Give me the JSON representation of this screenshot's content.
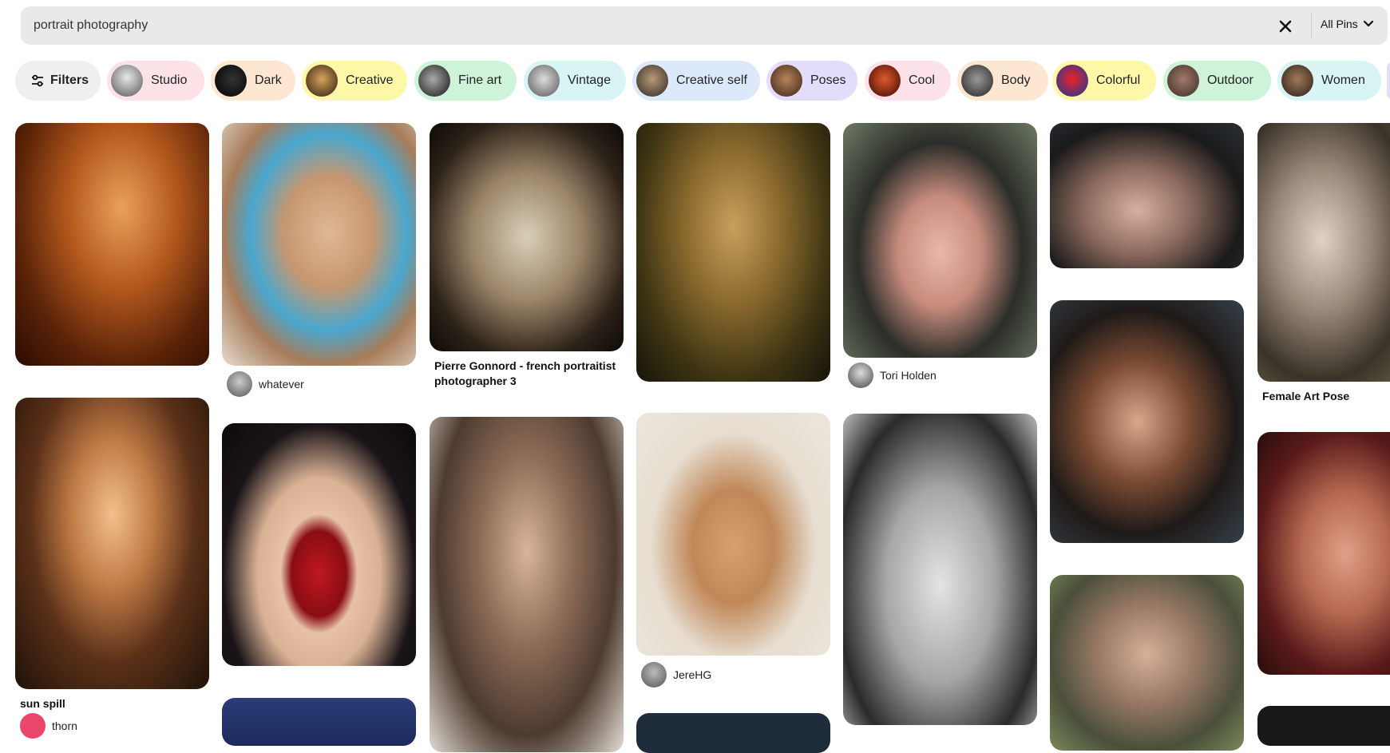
{
  "search": {
    "query": "portrait photography",
    "scope_label": "All Pins"
  },
  "filters_label": "Filters",
  "chips": [
    {
      "label": "Studio",
      "bg": "#fde2e8"
    },
    {
      "label": "Dark",
      "bg": "#fde6d2"
    },
    {
      "label": "Creative",
      "bg": "#fdf7a8"
    },
    {
      "label": "Fine art",
      "bg": "#cff3d8"
    },
    {
      "label": "Vintage",
      "bg": "#d9f4f4"
    },
    {
      "label": "Creative self",
      "bg": "#dce9fb"
    },
    {
      "label": "Poses",
      "bg": "#e4dcfb"
    },
    {
      "label": "Cool",
      "bg": "#fde2ea"
    },
    {
      "label": "Body",
      "bg": "#fde6d2"
    },
    {
      "label": "Colorful",
      "bg": "#fdf7a8"
    },
    {
      "label": "Outdoor",
      "bg": "#cff3d8"
    },
    {
      "label": "Women",
      "bg": "#d9f4f4"
    }
  ],
  "pins": {
    "c1r1": {
      "title": "",
      "owner": ""
    },
    "c1r2": {
      "title": "sun spill",
      "owner": "thorn"
    },
    "c2r1": {
      "title": "",
      "owner": "whatever"
    },
    "c3r1": {
      "title": "Pierre Gonnord - french portraitist photographer 3",
      "owner": ""
    },
    "c4r2": {
      "title": "",
      "owner": "JereHG"
    },
    "c5r1": {
      "title": "",
      "owner": "Tori Holden"
    },
    "c7r1": {
      "title": "Female Art Pose",
      "owner": ""
    }
  }
}
